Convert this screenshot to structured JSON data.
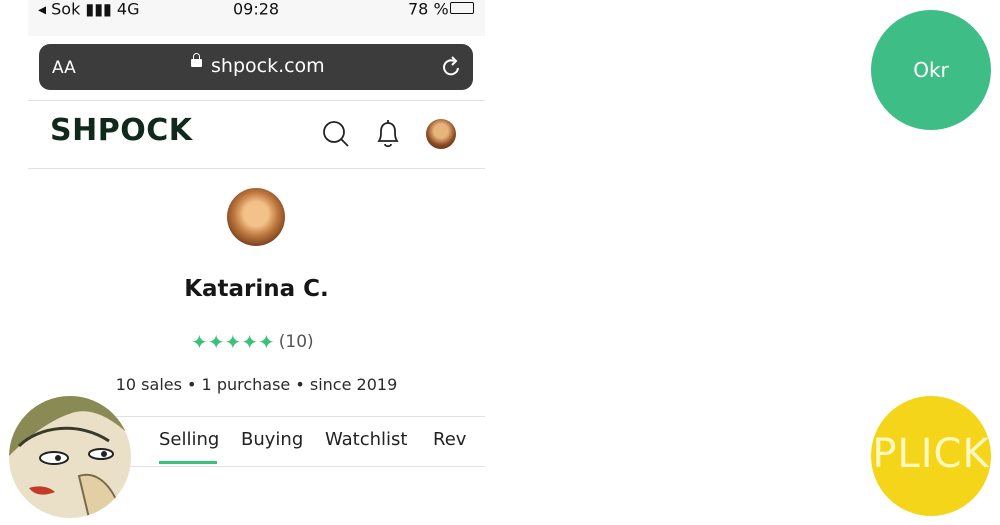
{
  "status_bar": {
    "carrier": "◂ Sok ▮▮▮ 4G",
    "clock": "09:28",
    "battery": "78 %"
  },
  "browser": {
    "text_size_label": "AA",
    "url": "shpock.com"
  },
  "header": {
    "brand": "SHPOCK"
  },
  "profile": {
    "name": "Katarina C.",
    "stars": "✦✦✦✦✦",
    "rating": 5,
    "rating_count": "(10)",
    "stats": "10 sales • 1 purchase • since 2019"
  },
  "tabs": [
    {
      "label": "Selling",
      "selected": true
    },
    {
      "label": "Buying"
    },
    {
      "label": "Watchlist"
    },
    {
      "label": "Rev"
    }
  ],
  "overlays": {
    "okr_label": "Okr",
    "plick_label": "PLICK"
  },
  "colors": {
    "accent_green": "#39c27a",
    "okr_bubble": "#3fbd87",
    "plick_bubble": "#f5d519",
    "url_bar": "#3c3c3c"
  },
  "icons": [
    "search-icon",
    "bell-icon",
    "reload-icon",
    "lock-icon"
  ]
}
